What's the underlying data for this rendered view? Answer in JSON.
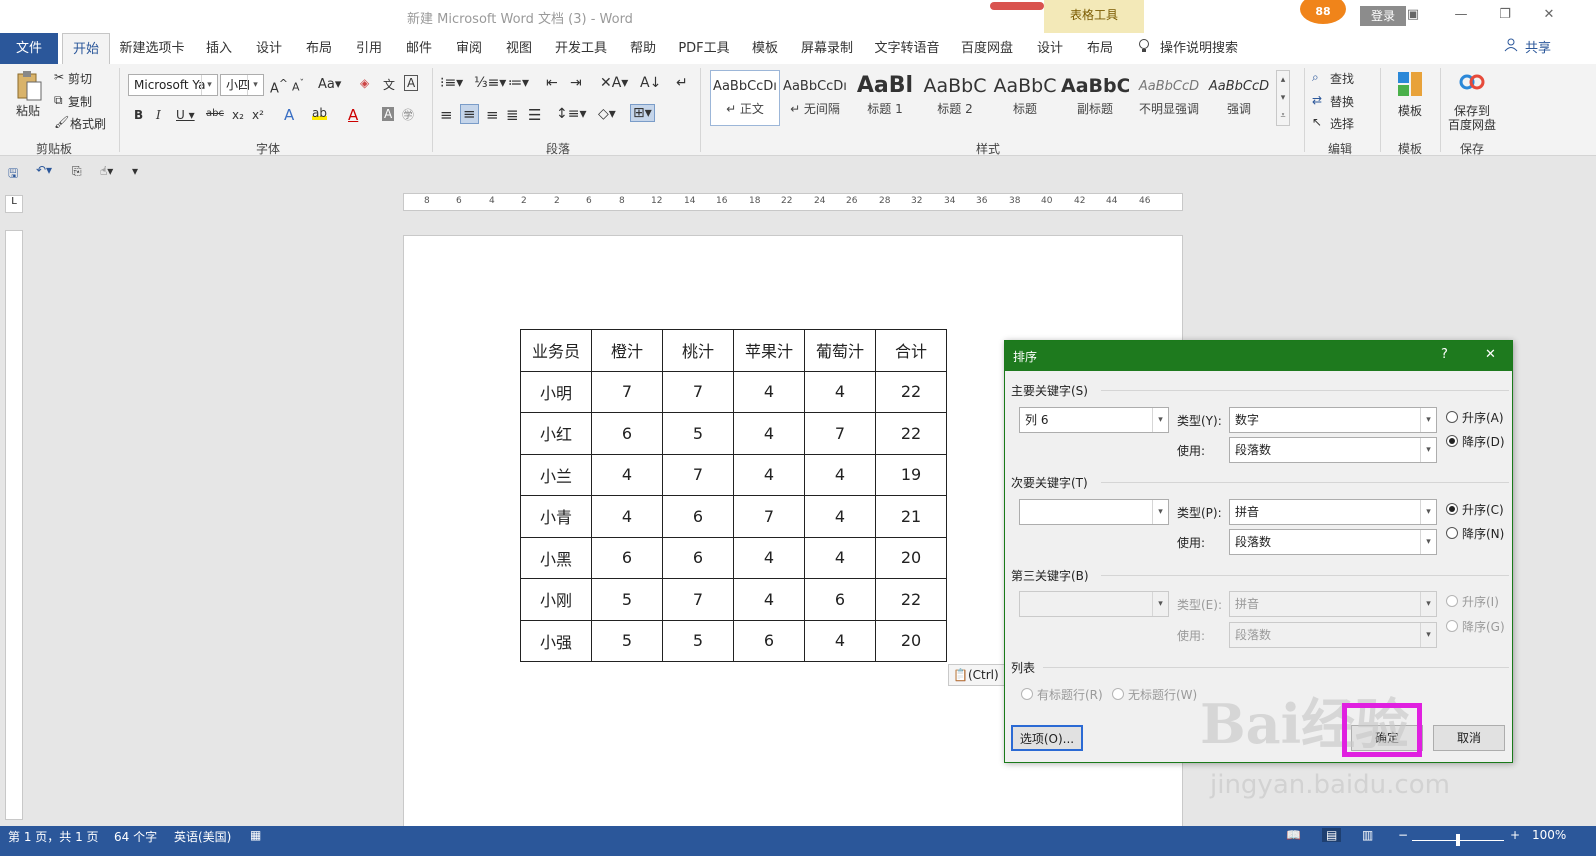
{
  "window": {
    "title": "新建 Microsoft Word 文档 (3)  -  Word",
    "table_tools": "表格工具",
    "badge": "88",
    "login": "登录",
    "controls": [
      "▣",
      "—",
      "❐",
      "✕"
    ]
  },
  "tabs": [
    "文件",
    "开始",
    "新建选项卡",
    "插入",
    "设计",
    "布局",
    "引用",
    "邮件",
    "审阅",
    "视图",
    "开发工具",
    "帮助",
    "PDF工具",
    "模板",
    "屏幕录制",
    "文字转语音",
    "百度网盘",
    "设计",
    "布局"
  ],
  "tell_me": "操作说明搜索",
  "share": "共享",
  "ribbon": {
    "clipboard": {
      "paste": "粘贴",
      "cut": "剪切",
      "copy": "复制",
      "format_painter": "格式刷",
      "label": "剪贴板"
    },
    "font": {
      "name": "Microsoft Ya",
      "size": "小四",
      "label": "字体"
    },
    "paragraph": {
      "label": "段落"
    },
    "styles": {
      "label": "样式",
      "items": [
        {
          "sample": "AaBbCcDı",
          "name": "↵ 正文"
        },
        {
          "sample": "AaBbCcDı",
          "name": "↵ 无间隔"
        },
        {
          "sample": "AaBl",
          "name": "标题 1"
        },
        {
          "sample": "AaBbC",
          "name": "标题 2"
        },
        {
          "sample": "AaBbC",
          "name": "标题"
        },
        {
          "sample": "AaBbC",
          "name": "副标题"
        },
        {
          "sample": "AaBbCcD",
          "name": "不明显强调"
        },
        {
          "sample": "AaBbCcD",
          "name": "强调"
        }
      ]
    },
    "editing": {
      "find": "查找",
      "replace": "替换",
      "select": "选择",
      "label": "编辑"
    },
    "template": {
      "btn": "模板",
      "label": "模板"
    },
    "save": {
      "btn1": "保存到",
      "btn2": "百度网盘",
      "label": "保存"
    }
  },
  "ruler_ticks": [
    "8",
    "6",
    "4",
    "2",
    "2",
    "6",
    "8",
    "12",
    "14",
    "16",
    "18",
    "22",
    "24",
    "26",
    "28",
    "32",
    "34",
    "36",
    "38",
    "40",
    "42",
    "44",
    "46"
  ],
  "table": {
    "headers": [
      "业务员",
      "橙汁",
      "桃汁",
      "苹果汁",
      "葡萄汁",
      "合计"
    ],
    "rows": [
      [
        "小明",
        "7",
        "7",
        "4",
        "4",
        "22"
      ],
      [
        "小红",
        "6",
        "5",
        "4",
        "7",
        "22"
      ],
      [
        "小兰",
        "4",
        "7",
        "4",
        "4",
        "19"
      ],
      [
        "小青",
        "4",
        "6",
        "7",
        "4",
        "21"
      ],
      [
        "小黑",
        "6",
        "6",
        "4",
        "4",
        "20"
      ],
      [
        "小刚",
        "5",
        "7",
        "4",
        "6",
        "22"
      ],
      [
        "小强",
        "5",
        "5",
        "6",
        "4",
        "20"
      ]
    ]
  },
  "paste_tag": "(Ctrl)",
  "dialog": {
    "title": "排序",
    "help": "?",
    "close": "✕",
    "primary": {
      "label": "主要关键字(S)",
      "key": "列 6",
      "type_label": "类型(Y):",
      "type": "数字",
      "use_label": "使用:",
      "use": "段落数",
      "asc": "升序(A)",
      "desc": "降序(D)",
      "selected": "desc"
    },
    "secondary": {
      "label": "次要关键字(T)",
      "key": "",
      "type_label": "类型(P):",
      "type": "拼音",
      "use_label": "使用:",
      "use": "段落数",
      "asc": "升序(C)",
      "desc": "降序(N)",
      "selected": "asc"
    },
    "tertiary": {
      "label": "第三关键字(B)",
      "key": "",
      "type_label": "类型(E):",
      "type": "拼音",
      "use_label": "使用:",
      "use": "段落数",
      "asc": "升序(I)",
      "desc": "降序(G)"
    },
    "list": {
      "label": "列表",
      "header_row": "有标题行(R)",
      "no_header_row": "无标题行(W)"
    },
    "options_btn": "选项(O)...",
    "ok_btn": "确定",
    "cancel_btn": "取消"
  },
  "status": {
    "page": "第 1 页，共 1 页",
    "words": "64 个字",
    "lang": "英语(美国)",
    "zoom": "100%"
  },
  "watermark": {
    "main": "Bai经验",
    "sub": "jingyan.baidu.com"
  },
  "colors": {
    "accent": "#2b579a",
    "dialog_title": "#1e7a1e",
    "highlight": "#e020e0"
  }
}
